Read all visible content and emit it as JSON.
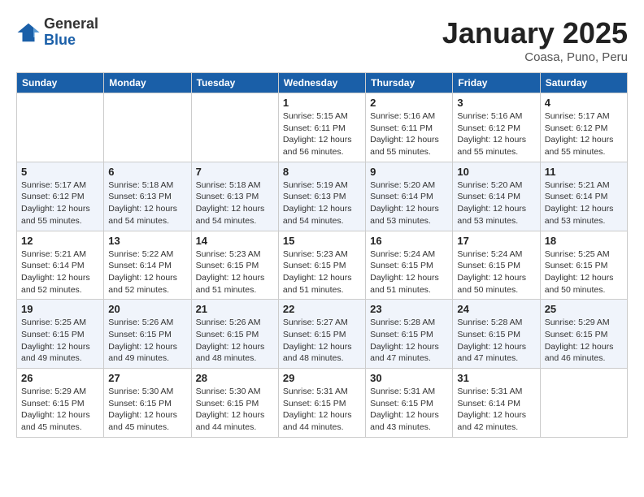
{
  "header": {
    "logo_general": "General",
    "logo_blue": "Blue",
    "month_title": "January 2025",
    "location": "Coasa, Puno, Peru"
  },
  "weekdays": [
    "Sunday",
    "Monday",
    "Tuesday",
    "Wednesday",
    "Thursday",
    "Friday",
    "Saturday"
  ],
  "weeks": [
    [
      {
        "day": "",
        "info": ""
      },
      {
        "day": "",
        "info": ""
      },
      {
        "day": "",
        "info": ""
      },
      {
        "day": "1",
        "info": "Sunrise: 5:15 AM\nSunset: 6:11 PM\nDaylight: 12 hours\nand 56 minutes."
      },
      {
        "day": "2",
        "info": "Sunrise: 5:16 AM\nSunset: 6:11 PM\nDaylight: 12 hours\nand 55 minutes."
      },
      {
        "day": "3",
        "info": "Sunrise: 5:16 AM\nSunset: 6:12 PM\nDaylight: 12 hours\nand 55 minutes."
      },
      {
        "day": "4",
        "info": "Sunrise: 5:17 AM\nSunset: 6:12 PM\nDaylight: 12 hours\nand 55 minutes."
      }
    ],
    [
      {
        "day": "5",
        "info": "Sunrise: 5:17 AM\nSunset: 6:12 PM\nDaylight: 12 hours\nand 55 minutes."
      },
      {
        "day": "6",
        "info": "Sunrise: 5:18 AM\nSunset: 6:13 PM\nDaylight: 12 hours\nand 54 minutes."
      },
      {
        "day": "7",
        "info": "Sunrise: 5:18 AM\nSunset: 6:13 PM\nDaylight: 12 hours\nand 54 minutes."
      },
      {
        "day": "8",
        "info": "Sunrise: 5:19 AM\nSunset: 6:13 PM\nDaylight: 12 hours\nand 54 minutes."
      },
      {
        "day": "9",
        "info": "Sunrise: 5:20 AM\nSunset: 6:14 PM\nDaylight: 12 hours\nand 53 minutes."
      },
      {
        "day": "10",
        "info": "Sunrise: 5:20 AM\nSunset: 6:14 PM\nDaylight: 12 hours\nand 53 minutes."
      },
      {
        "day": "11",
        "info": "Sunrise: 5:21 AM\nSunset: 6:14 PM\nDaylight: 12 hours\nand 53 minutes."
      }
    ],
    [
      {
        "day": "12",
        "info": "Sunrise: 5:21 AM\nSunset: 6:14 PM\nDaylight: 12 hours\nand 52 minutes."
      },
      {
        "day": "13",
        "info": "Sunrise: 5:22 AM\nSunset: 6:14 PM\nDaylight: 12 hours\nand 52 minutes."
      },
      {
        "day": "14",
        "info": "Sunrise: 5:23 AM\nSunset: 6:15 PM\nDaylight: 12 hours\nand 51 minutes."
      },
      {
        "day": "15",
        "info": "Sunrise: 5:23 AM\nSunset: 6:15 PM\nDaylight: 12 hours\nand 51 minutes."
      },
      {
        "day": "16",
        "info": "Sunrise: 5:24 AM\nSunset: 6:15 PM\nDaylight: 12 hours\nand 51 minutes."
      },
      {
        "day": "17",
        "info": "Sunrise: 5:24 AM\nSunset: 6:15 PM\nDaylight: 12 hours\nand 50 minutes."
      },
      {
        "day": "18",
        "info": "Sunrise: 5:25 AM\nSunset: 6:15 PM\nDaylight: 12 hours\nand 50 minutes."
      }
    ],
    [
      {
        "day": "19",
        "info": "Sunrise: 5:25 AM\nSunset: 6:15 PM\nDaylight: 12 hours\nand 49 minutes."
      },
      {
        "day": "20",
        "info": "Sunrise: 5:26 AM\nSunset: 6:15 PM\nDaylight: 12 hours\nand 49 minutes."
      },
      {
        "day": "21",
        "info": "Sunrise: 5:26 AM\nSunset: 6:15 PM\nDaylight: 12 hours\nand 48 minutes."
      },
      {
        "day": "22",
        "info": "Sunrise: 5:27 AM\nSunset: 6:15 PM\nDaylight: 12 hours\nand 48 minutes."
      },
      {
        "day": "23",
        "info": "Sunrise: 5:28 AM\nSunset: 6:15 PM\nDaylight: 12 hours\nand 47 minutes."
      },
      {
        "day": "24",
        "info": "Sunrise: 5:28 AM\nSunset: 6:15 PM\nDaylight: 12 hours\nand 47 minutes."
      },
      {
        "day": "25",
        "info": "Sunrise: 5:29 AM\nSunset: 6:15 PM\nDaylight: 12 hours\nand 46 minutes."
      }
    ],
    [
      {
        "day": "26",
        "info": "Sunrise: 5:29 AM\nSunset: 6:15 PM\nDaylight: 12 hours\nand 45 minutes."
      },
      {
        "day": "27",
        "info": "Sunrise: 5:30 AM\nSunset: 6:15 PM\nDaylight: 12 hours\nand 45 minutes."
      },
      {
        "day": "28",
        "info": "Sunrise: 5:30 AM\nSunset: 6:15 PM\nDaylight: 12 hours\nand 44 minutes."
      },
      {
        "day": "29",
        "info": "Sunrise: 5:31 AM\nSunset: 6:15 PM\nDaylight: 12 hours\nand 44 minutes."
      },
      {
        "day": "30",
        "info": "Sunrise: 5:31 AM\nSunset: 6:15 PM\nDaylight: 12 hours\nand 43 minutes."
      },
      {
        "day": "31",
        "info": "Sunrise: 5:31 AM\nSunset: 6:14 PM\nDaylight: 12 hours\nand 42 minutes."
      },
      {
        "day": "",
        "info": ""
      }
    ]
  ]
}
